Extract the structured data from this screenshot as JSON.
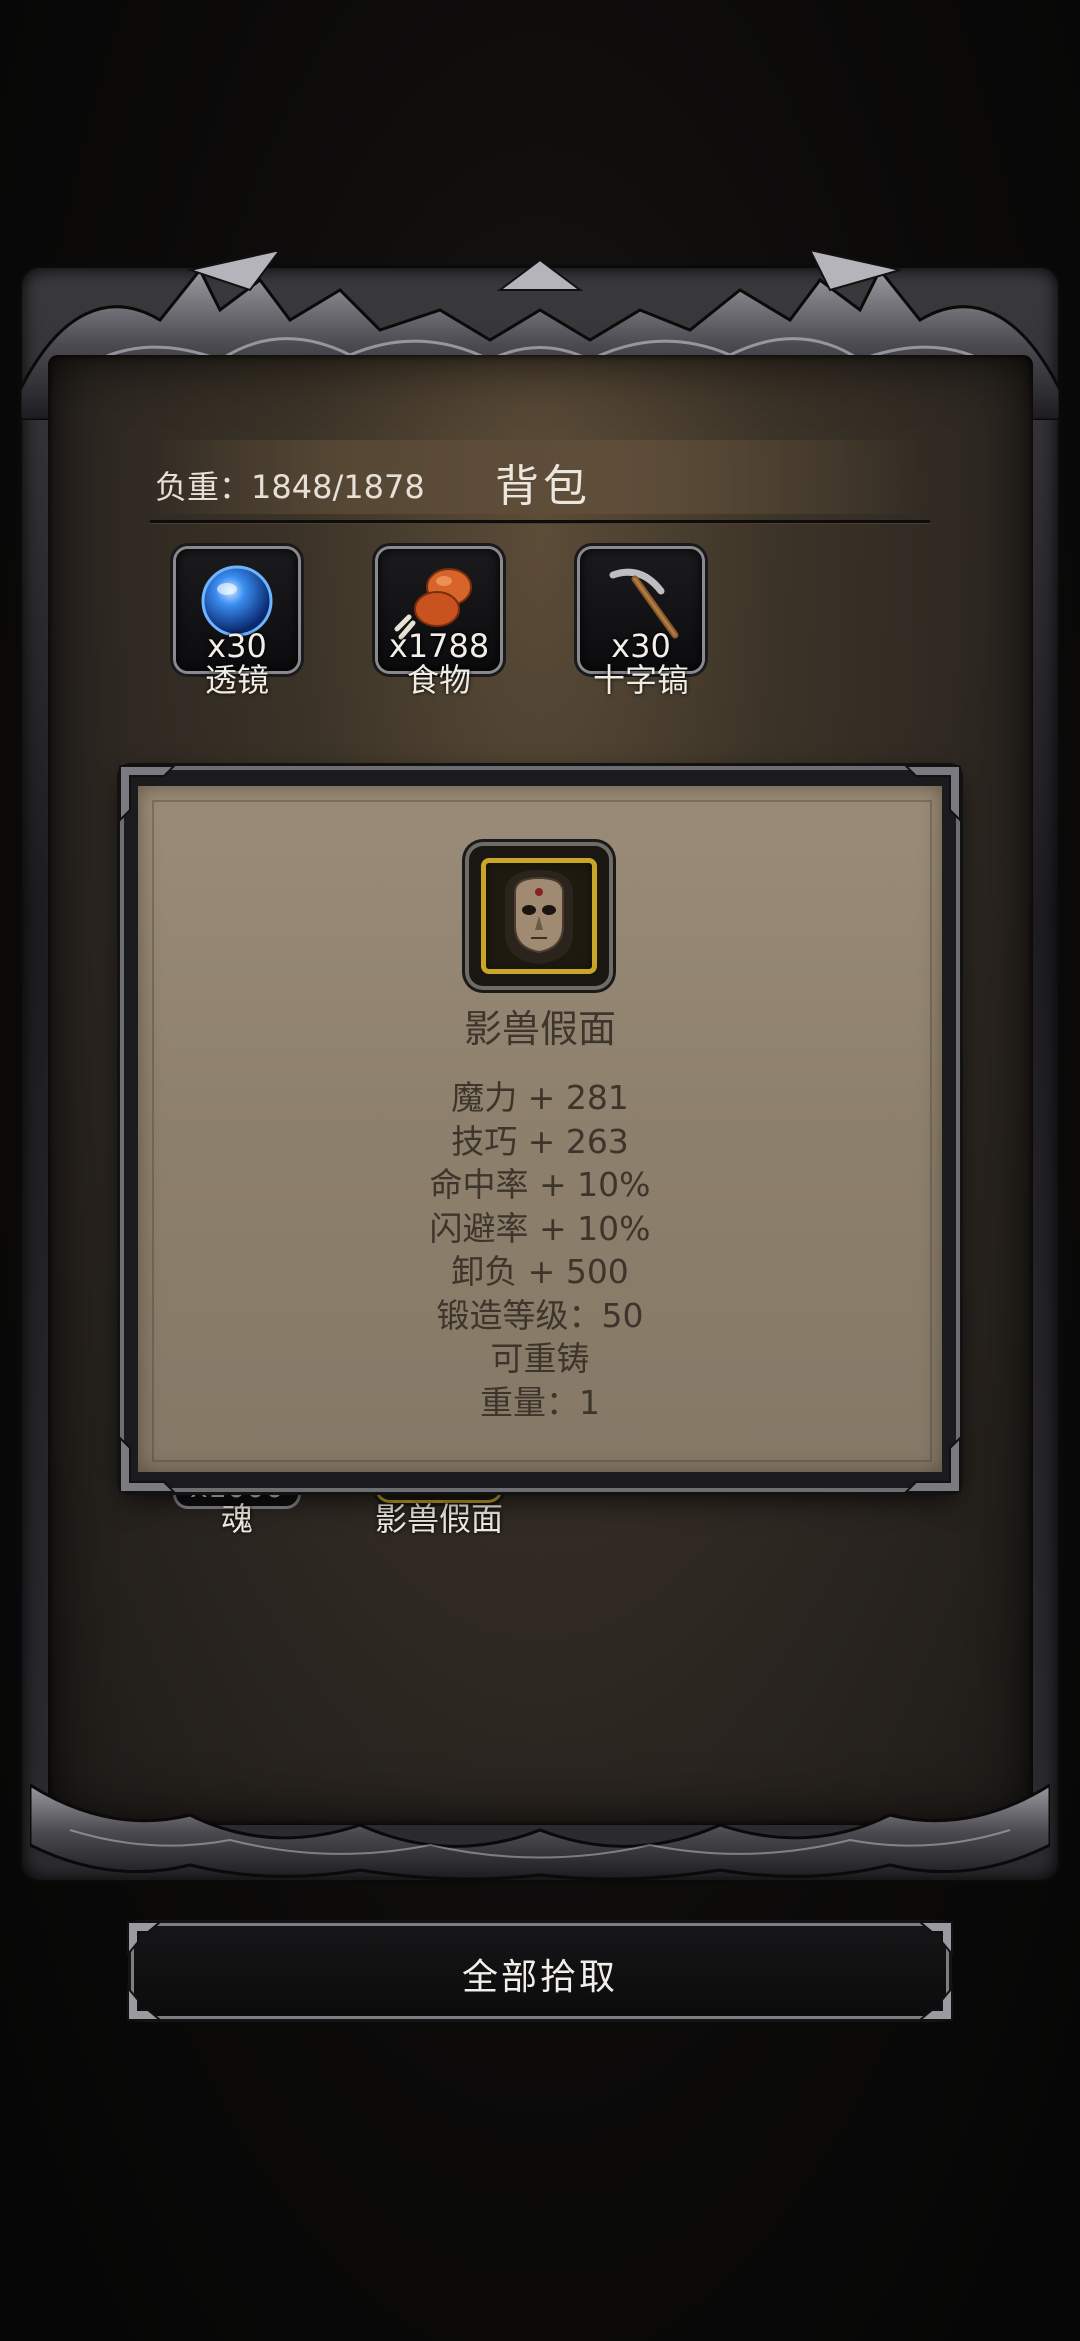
{
  "header": {
    "weight_label": "负重：",
    "weight_value": "1848/1878",
    "title": "背包"
  },
  "inventory": [
    {
      "name": "透镜",
      "count": "x30",
      "icon": "lens-orb-icon"
    },
    {
      "name": "食物",
      "count": "x1788",
      "icon": "meat-food-icon"
    },
    {
      "name": "十字镐",
      "count": "x30",
      "icon": "pickaxe-icon"
    }
  ],
  "buried_items": [
    {
      "name": "魂",
      "count": "x1000"
    },
    {
      "name": "影兽假面"
    }
  ],
  "popup": {
    "item_name": "影兽假面",
    "item_icon": "shadow-beast-mask-icon",
    "stats": [
      "魔力 + 281",
      "技巧 + 263",
      "命中率 + 10%",
      "闪避率 + 10%",
      "卸负 + 500",
      "锻造等级：50",
      "可重铸",
      "重量：1"
    ]
  },
  "button": {
    "label": "全部拾取"
  },
  "colors": {
    "background": "#0c0b0a",
    "panel": "#3b3327",
    "popup_parchment": "#8d806c",
    "slot_gold": "#c9a62a",
    "text_light": "#f0ece4",
    "text_dark": "#3d352c"
  }
}
